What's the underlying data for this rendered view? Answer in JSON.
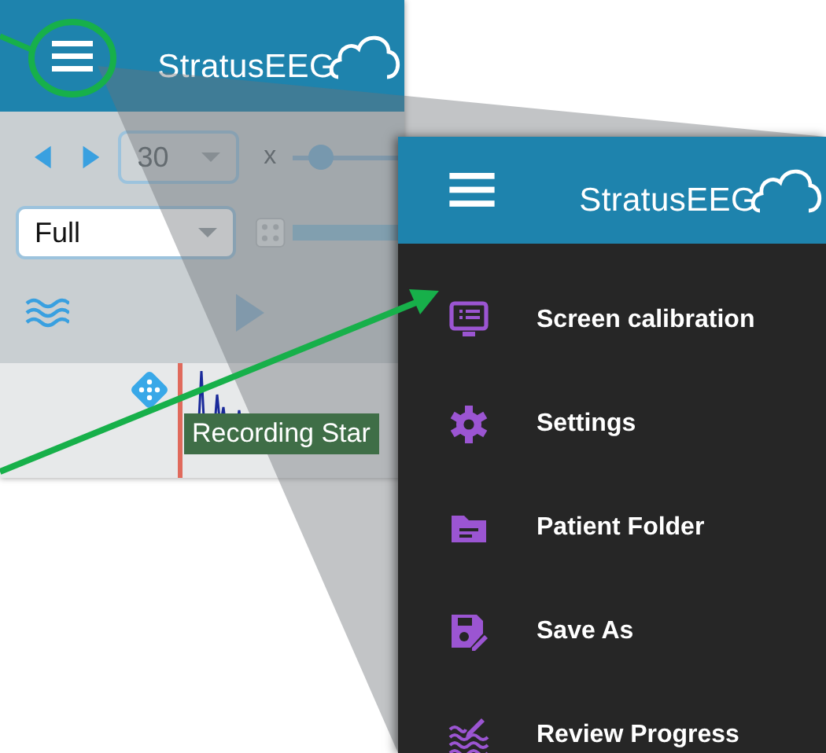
{
  "app_panel": {
    "logo": "StratusEEG",
    "page_size": "30",
    "multiplier": "x",
    "zoom_slider": {
      "level": 0.15
    },
    "montage": "Full",
    "event_label": "Recording Star"
  },
  "menu_panel": {
    "logo": "StratusEEG",
    "items": [
      {
        "label": "Screen calibration",
        "kind": "monitor"
      },
      {
        "label": "Settings",
        "kind": "gear"
      },
      {
        "label": "Patient Folder",
        "kind": "folder"
      },
      {
        "label": "Save As",
        "kind": "save"
      },
      {
        "label": "Review Progress",
        "kind": "waves"
      }
    ]
  }
}
